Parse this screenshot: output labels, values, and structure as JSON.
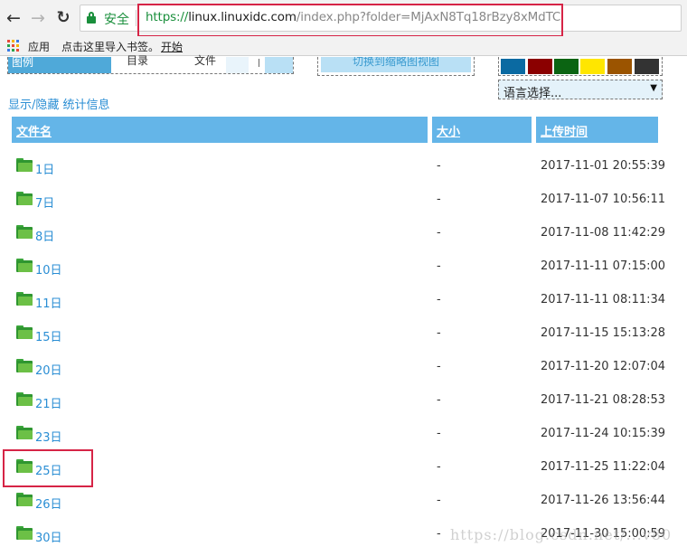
{
  "browser": {
    "secure_label": "安全",
    "url_scheme": "https://",
    "url_host": "linux.linuxidc.com",
    "url_path": "/index.php?folder=MjAxN8Tq18rBzy8xMdTC"
  },
  "bookmarks": {
    "apps_label": "应用",
    "import_label": "点击这里导入书签。",
    "start_label": "开始"
  },
  "legend": {
    "title": "图例",
    "dir_label": "目录",
    "file_label": "文件"
  },
  "switch_view_label": "切换到缩略图视图",
  "theme_colors": [
    "#0b6aa2",
    "#8b0000",
    "#0b6412",
    "#ffe600",
    "#9b5400",
    "#333333"
  ],
  "lang_select": {
    "label": "语言选择..."
  },
  "toggle_stats_label": "显示/隐藏 统计信息",
  "table": {
    "headers": {
      "name": "文件名",
      "size": "大小",
      "time": "上传时间"
    },
    "rows": [
      {
        "name": "1日",
        "size": "-",
        "time": "2017-11-01 20:55:39"
      },
      {
        "name": "7日",
        "size": "-",
        "time": "2017-11-07 10:56:11"
      },
      {
        "name": "8日",
        "size": "-",
        "time": "2017-11-08 11:42:29"
      },
      {
        "name": "10日",
        "size": "-",
        "time": "2017-11-11 07:15:00"
      },
      {
        "name": "11日",
        "size": "-",
        "time": "2017-11-11 08:11:34"
      },
      {
        "name": "15日",
        "size": "-",
        "time": "2017-11-15 15:13:28"
      },
      {
        "name": "20日",
        "size": "-",
        "time": "2017-11-20 12:07:04"
      },
      {
        "name": "21日",
        "size": "-",
        "time": "2017-11-21 08:28:53"
      },
      {
        "name": "23日",
        "size": "-",
        "time": "2017-11-24 10:15:39"
      },
      {
        "name": "25日",
        "size": "-",
        "time": "2017-11-25 11:22:04"
      },
      {
        "name": "26日",
        "size": "-",
        "time": "2017-11-26 13:56:44"
      },
      {
        "name": "30日",
        "size": "-",
        "time": "2017-11-30 15:00:59"
      }
    ]
  },
  "watermark": "https://blog.csdn.net/...v80"
}
